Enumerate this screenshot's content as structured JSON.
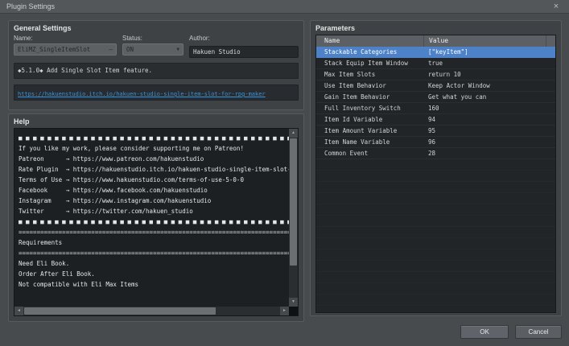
{
  "window": {
    "title": "Plugin Settings"
  },
  "icons": {
    "close": "×",
    "combo_dash": "—",
    "chevron_down": "▼",
    "scroll_up": "▲",
    "scroll_down": "▼",
    "scroll_left": "◄",
    "scroll_right": "►"
  },
  "general": {
    "section_title": "General Settings",
    "name_label": "Name:",
    "name_value": "EliMZ_SingleItemSlot",
    "status_label": "Status:",
    "status_value": "ON",
    "author_label": "Author:",
    "author_value": "Hakuen Studio",
    "description": "◆5.1.0◆ Add Single Slot Item feature.",
    "link": "https://hakuenstudio.itch.io/hakuen-studio-single-item-slot-for-rpg-maker"
  },
  "help": {
    "section_title": "Help",
    "lines": [
      "■ ■ ■ ■ ■ ■ ■ ■ ■ ■ ■ ■ ■ ■ ■ ■ ■ ■ ■ ■ ■ ■ ■ ■ ■ ■ ■ ■ ■ ■ ■ ■ ■ ■ ■ ■ ■ ■",
      "If you like my work, please consider supporting me on Patreon!",
      "Patreon      → https://www.patreon.com/hakuenstudio",
      "Rate Plugin  → https://hakuenstudio.itch.io/hakuen-studio-single-item-slot-f",
      "Terms of Use → https://www.hakuenstudio.com/terms-of-use-5-0-0",
      "Facebook     → https://www.facebook.com/hakuenstudio",
      "Instagram    → https://www.instagram.com/hakuenstudio",
      "Twitter      → https://twitter.com/hakuen_studio",
      "■ ■ ■ ■ ■ ■ ■ ■ ■ ■ ■ ■ ■ ■ ■ ■ ■ ■ ■ ■ ■ ■ ■ ■ ■ ■ ■ ■ ■ ■ ■ ■ ■ ■ ■ ■ ■ ■",
      "============================================================================",
      "Requirements",
      "============================================================================",
      "",
      "Need Eli Book.",
      "Order After Eli Book.",
      "",
      "Not compatible with Eli Max Items"
    ]
  },
  "parameters": {
    "section_title": "Parameters",
    "columns": [
      "Name",
      "Value"
    ],
    "selected_row_color": "#4d82c8",
    "rows": [
      {
        "name": "Stackable Categories",
        "value": "[\"keyItem\"]",
        "selected": true
      },
      {
        "name": "Stack Equip Item Window",
        "value": "true"
      },
      {
        "name": "Max Item Slots",
        "value": "return 10"
      },
      {
        "name": "Use Item Behavior",
        "value": "Keep Actor Window"
      },
      {
        "name": "Gain Item Behavior",
        "value": "Get what you can"
      },
      {
        "name": "Full Inventory Switch",
        "value": "160"
      },
      {
        "name": "Item Id Variable",
        "value": "94"
      },
      {
        "name": "Item Amount Variable",
        "value": "95"
      },
      {
        "name": "Item Name Variable",
        "value": "96"
      },
      {
        "name": "Common Event",
        "value": "28"
      }
    ]
  },
  "footer": {
    "ok_label": "OK",
    "cancel_label": "Cancel"
  }
}
